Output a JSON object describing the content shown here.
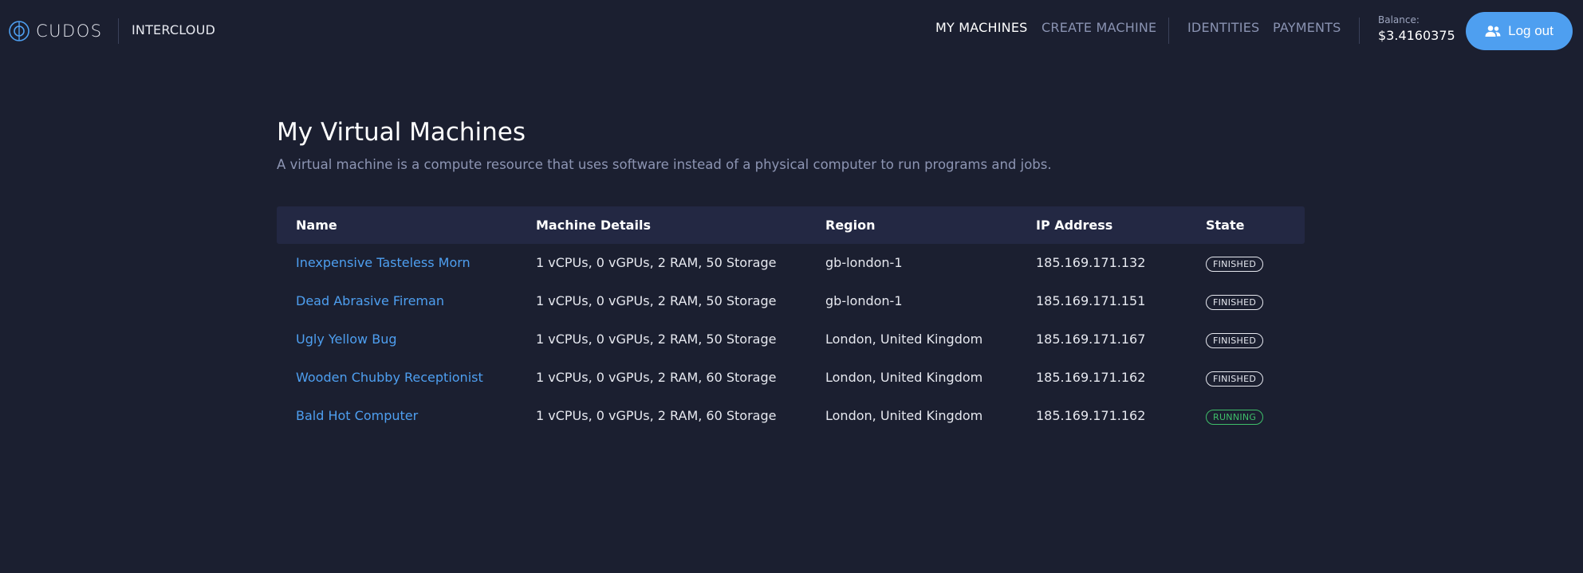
{
  "header": {
    "logo_text": "CUDOS",
    "product_name": "INTERCLOUD",
    "nav": [
      {
        "label": "MY MACHINES",
        "active": true
      },
      {
        "label": "CREATE MACHINE",
        "active": false
      },
      {
        "label": "IDENTITIES",
        "active": false
      },
      {
        "label": "PAYMENTS",
        "active": false
      }
    ],
    "balance_label": "Balance:",
    "balance_value": "$3.4160375",
    "logout_label": "Log out"
  },
  "main": {
    "title": "My Virtual Machines",
    "subtitle": "A virtual machine is a compute resource that uses software instead of a physical computer to run programs and jobs."
  },
  "table": {
    "columns": [
      "Name",
      "Machine Details",
      "Region",
      "IP Address",
      "State"
    ],
    "rows": [
      {
        "name": "Inexpensive Tasteless Morn",
        "details": "1 vCPUs, 0 vGPUs, 2 RAM, 50 Storage",
        "region": "gb-london-1",
        "ip": "185.169.171.132",
        "state": "FINISHED"
      },
      {
        "name": "Dead Abrasive Fireman",
        "details": "1 vCPUs, 0 vGPUs, 2 RAM, 50 Storage",
        "region": "gb-london-1",
        "ip": "185.169.171.151",
        "state": "FINISHED"
      },
      {
        "name": "Ugly Yellow Bug",
        "details": "1 vCPUs, 0 vGPUs, 2 RAM, 50 Storage",
        "region": "London, United Kingdom",
        "ip": "185.169.171.167",
        "state": "FINISHED"
      },
      {
        "name": "Wooden Chubby Receptionist",
        "details": "1 vCPUs, 0 vGPUs, 2 RAM, 60 Storage",
        "region": "London, United Kingdom",
        "ip": "185.169.171.162",
        "state": "FINISHED"
      },
      {
        "name": "Bald Hot Computer",
        "details": "1 vCPUs, 0 vGPUs, 2 RAM, 60 Storage",
        "region": "London, United Kingdom",
        "ip": "185.169.171.162",
        "state": "RUNNING"
      }
    ]
  },
  "colors": {
    "background": "#1b1f30",
    "accent": "#4e9ff0",
    "running": "#3fbf6a",
    "header_row": "#232843"
  }
}
